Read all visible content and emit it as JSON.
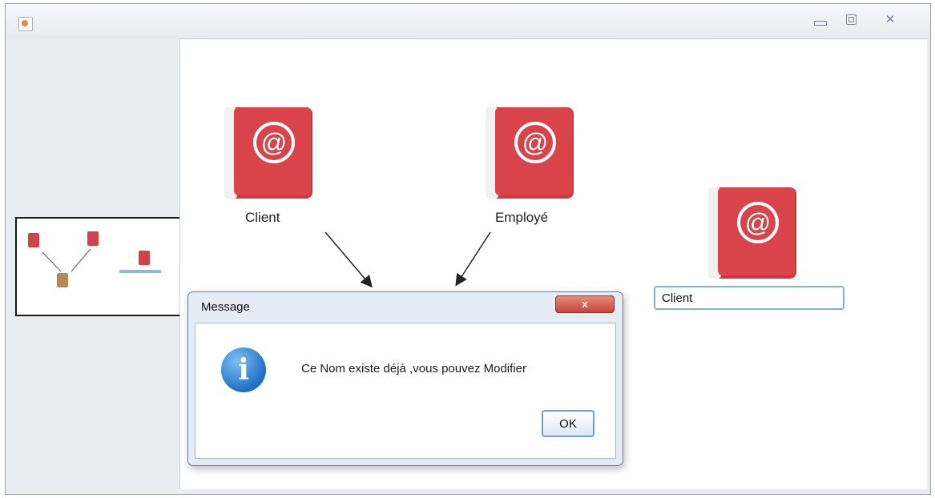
{
  "window": {
    "title": "",
    "controls": {
      "minimize_icon": "minimize-icon",
      "maximize_icon": "maximize-icon",
      "close_glyph": "✕"
    }
  },
  "diagram": {
    "nodes": [
      {
        "label": "Client",
        "icon": "address-book-icon"
      },
      {
        "label": "Employé",
        "icon": "address-book-icon"
      },
      {
        "label": "",
        "icon": "address-book-icon"
      }
    ],
    "edit_field_value": "Client",
    "accent_color": "#d2353d"
  },
  "dialog": {
    "title": "Message",
    "close_glyph": "x",
    "message": "Ce Nom existe déjà ,vous pouvez Modifier",
    "icon": "information-icon",
    "ok_label": "OK"
  }
}
